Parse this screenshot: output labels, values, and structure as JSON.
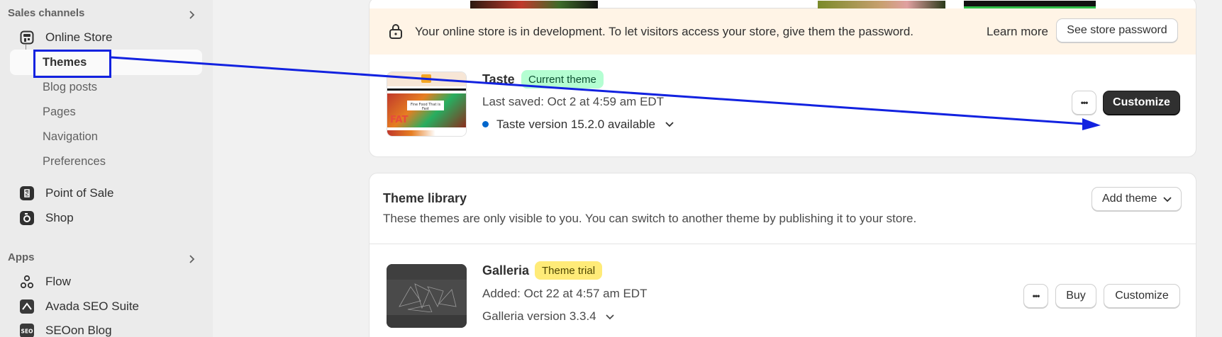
{
  "sidebar": {
    "sales_channels_label": "Sales channels",
    "online_store": "Online Store",
    "sub_items": [
      "Themes",
      "Blog posts",
      "Pages",
      "Navigation",
      "Preferences"
    ],
    "point_of_sale": "Point of Sale",
    "shop": "Shop",
    "apps_label": "Apps",
    "apps": [
      "Flow",
      "Avada SEO Suite",
      "SEOon Blog"
    ],
    "seo_icon_text": "SEO"
  },
  "banner": {
    "message": "Your online store is in development. To let visitors access your store, give them the password.",
    "learn_more": "Learn more",
    "see_password": "See store password"
  },
  "current_theme": {
    "name": "Taste",
    "badge": "Current theme",
    "last_saved": "Last saved: Oct 2 at 4:59 am EDT",
    "version_notice": "Taste version 15.2.0 available",
    "more": "•••",
    "customize": "Customize",
    "thumb_caption": "Fine Food That is Fast",
    "thumb_word": "FAT"
  },
  "library": {
    "title": "Theme library",
    "description": "These themes are only visible to you. You can switch to another theme by publishing it to your store.",
    "add_theme": "Add theme"
  },
  "galleria": {
    "name": "Galleria",
    "badge": "Theme trial",
    "added": "Added: Oct 22 at 4:57 am EDT",
    "version": "Galleria version 3.3.4",
    "more": "•••",
    "buy": "Buy",
    "customize": "Customize"
  },
  "colors": {
    "accent_dark": "#303030",
    "badge_green": "#b4fed2",
    "badge_yellow": "#ffeb78",
    "annotation_blue": "#1222e0",
    "dev_banner": "#fff4e6",
    "version_dot": "#0066cc"
  }
}
